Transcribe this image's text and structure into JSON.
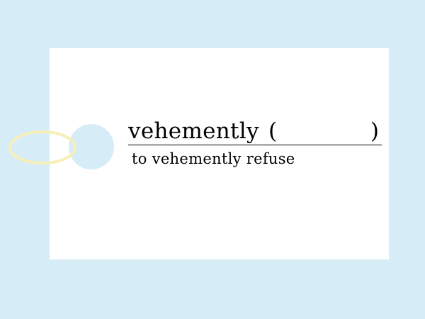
{
  "card": {
    "word": "vehemently",
    "paren_open": "(",
    "paren_close": ")",
    "example": "to vehemently refuse"
  },
  "colors": {
    "background": "#d6ecf7",
    "card": "#ffffff",
    "ring": "#f6f0b8",
    "text": "#000000"
  }
}
